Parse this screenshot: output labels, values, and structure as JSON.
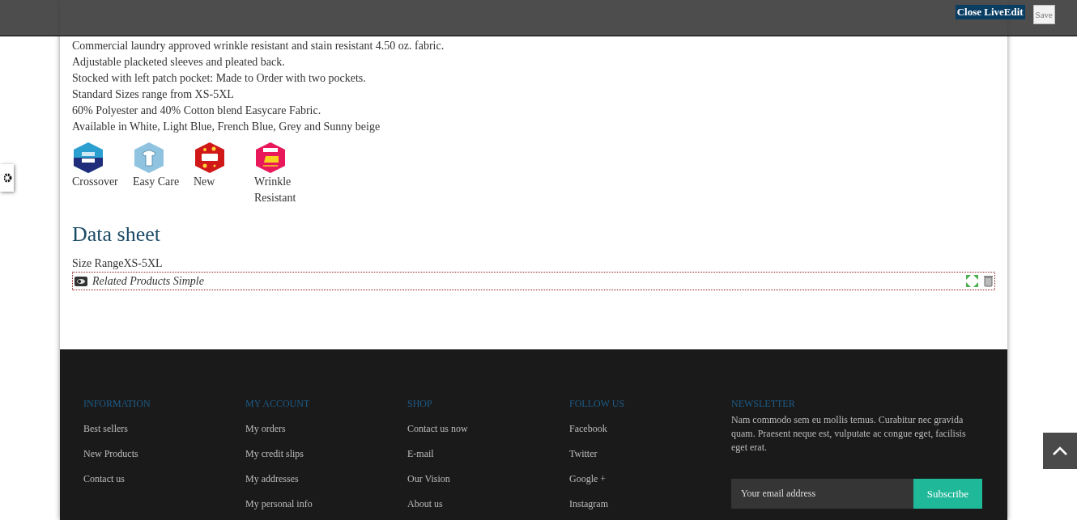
{
  "liveedit_bar": {
    "close_label": "Close LiveEdit",
    "save_label": "Save"
  },
  "description": [
    "Commercial laundry approved wrinkle resistant and stain resistant 4.50 oz. fabric.",
    "Adjustable placketed sleeves and pleated back.",
    "Stocked with left patch pocket: Made to Order with two pockets.",
    "Standard Sizes range from XS-5XL",
    "60% Polyester and 40% Cotton blend Easycare Fabric.",
    "Available in White, Light Blue, French Blue, Grey and Sunny beige"
  ],
  "features": [
    {
      "kind": "crossover",
      "label": "Crossover"
    },
    {
      "kind": "easycare",
      "label": "Easy Care"
    },
    {
      "kind": "new",
      "label": "New"
    },
    {
      "kind": "wrinkle",
      "label": "Wrinkle Resistant"
    }
  ],
  "data_sheet": {
    "title": "Data sheet",
    "rows": [
      {
        "name": "Size Range",
        "value": "XS-5XL"
      }
    ]
  },
  "module": {
    "title": "Related Products Simple"
  },
  "footer": {
    "columns": [
      {
        "title": "INFORMATION",
        "links": [
          "Best sellers",
          "New Products",
          "Contact us"
        ]
      },
      {
        "title": "MY ACCOUNT",
        "links": [
          "My orders",
          "My credit slips",
          "My addresses",
          "My personal info"
        ]
      },
      {
        "title": "SHOP",
        "links": [
          "Contact us now",
          "E-mail",
          "Our Vision",
          "About us"
        ]
      },
      {
        "title": "FOLLOW US",
        "links": [
          "Facebook",
          "Twitter",
          "Google +",
          "Instagram"
        ]
      }
    ],
    "newsletter": {
      "title": "NEWSLETTER",
      "text": "Nam commodo sem eu mollis temus. Curabitur nec gravida quam. Praesent neque est, vulputate ac congue eget, facilisis eget erat.",
      "placeholder": "Your email address",
      "button": "Subscribe"
    }
  }
}
